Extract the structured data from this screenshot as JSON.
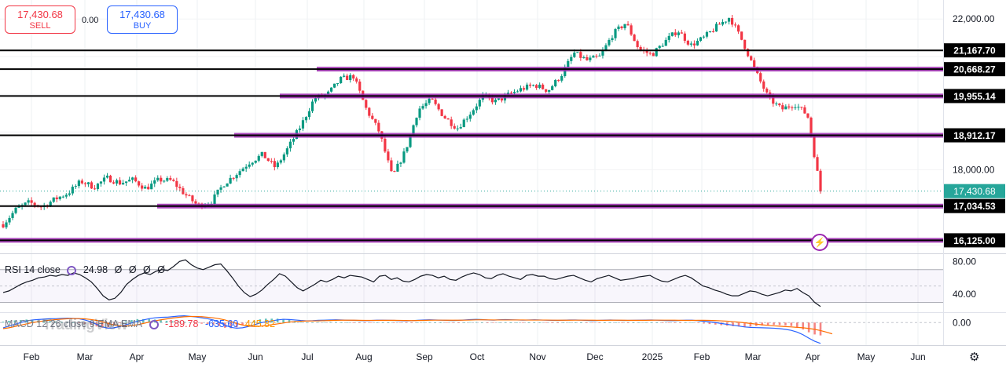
{
  "trade": {
    "sell_price": "17,430.68",
    "sell_label": "SELL",
    "buy_price": "17,430.68",
    "buy_label": "BUY",
    "spread": "0.00"
  },
  "chart_data": [
    {
      "type": "candlestick",
      "title": "",
      "x_ticks": [
        "Feb",
        "Mar",
        "Apr",
        "May",
        "Jun",
        "Jul",
        "Aug",
        "Sep",
        "Oct",
        "Nov",
        "Dec",
        "2025",
        "Feb",
        "Mar",
        "Apr",
        "May",
        "Jun"
      ],
      "y_ticks": [
        "22,000.00",
        "18,000.00"
      ],
      "ylim": [
        15800,
        22400
      ],
      "current_price": 17430.68,
      "current_price_label": "17,430.68",
      "close_series": [
        {
          "date": "2024-01-22",
          "close": 16550
        },
        {
          "date": "2024-01-29",
          "close": 16950
        },
        {
          "date": "2024-02-05",
          "close": 17130
        },
        {
          "date": "2024-02-12",
          "close": 17010
        },
        {
          "date": "2024-02-19",
          "close": 17220
        },
        {
          "date": "2024-02-26",
          "close": 17380
        },
        {
          "date": "2024-03-04",
          "close": 17690
        },
        {
          "date": "2024-03-11",
          "close": 17540
        },
        {
          "date": "2024-03-18",
          "close": 17780
        },
        {
          "date": "2024-03-25",
          "close": 17650
        },
        {
          "date": "2024-04-01",
          "close": 17730
        },
        {
          "date": "2024-04-08",
          "close": 17500
        },
        {
          "date": "2024-04-15",
          "close": 17730
        },
        {
          "date": "2024-04-22",
          "close": 17710
        },
        {
          "date": "2024-04-29",
          "close": 17350
        },
        {
          "date": "2024-05-06",
          "close": 17050
        },
        {
          "date": "2024-05-13",
          "close": 17130
        },
        {
          "date": "2024-05-20",
          "close": 17620
        },
        {
          "date": "2024-05-27",
          "close": 17900
        },
        {
          "date": "2024-06-03",
          "close": 18200
        },
        {
          "date": "2024-06-10",
          "close": 18400
        },
        {
          "date": "2024-06-17",
          "close": 18050
        },
        {
          "date": "2024-06-24",
          "close": 18600
        },
        {
          "date": "2024-07-01",
          "close": 19200
        },
        {
          "date": "2024-07-08",
          "close": 19900
        },
        {
          "date": "2024-07-15",
          "close": 20000
        },
        {
          "date": "2024-07-22",
          "close": 20400
        },
        {
          "date": "2024-07-29",
          "close": 20480
        },
        {
          "date": "2024-08-05",
          "close": 19600
        },
        {
          "date": "2024-08-12",
          "close": 19000
        },
        {
          "date": "2024-08-19",
          "close": 17800
        },
        {
          "date": "2024-08-26",
          "close": 18500
        },
        {
          "date": "2024-09-02",
          "close": 19600
        },
        {
          "date": "2024-09-09",
          "close": 19850
        },
        {
          "date": "2024-09-16",
          "close": 19400
        },
        {
          "date": "2024-09-23",
          "close": 19100
        },
        {
          "date": "2024-09-30",
          "close": 19500
        },
        {
          "date": "2024-10-07",
          "close": 19950
        },
        {
          "date": "2024-10-14",
          "close": 19800
        },
        {
          "date": "2024-10-21",
          "close": 20000
        },
        {
          "date": "2024-10-28",
          "close": 20150
        },
        {
          "date": "2024-11-04",
          "close": 20250
        },
        {
          "date": "2024-11-11",
          "close": 20100
        },
        {
          "date": "2024-11-18",
          "close": 20500
        },
        {
          "date": "2024-11-25",
          "close": 21100
        },
        {
          "date": "2024-12-02",
          "close": 20900
        },
        {
          "date": "2024-12-09",
          "close": 21000
        },
        {
          "date": "2024-12-16",
          "close": 21600
        },
        {
          "date": "2024-12-23",
          "close": 21900
        },
        {
          "date": "2024-12-30",
          "close": 21200
        },
        {
          "date": "2025-01-06",
          "close": 21050
        },
        {
          "date": "2025-01-13",
          "close": 21400
        },
        {
          "date": "2025-01-20",
          "close": 21700
        },
        {
          "date": "2025-01-27",
          "close": 21300
        },
        {
          "date": "2025-02-03",
          "close": 21500
        },
        {
          "date": "2025-02-10",
          "close": 21800
        },
        {
          "date": "2025-02-17",
          "close": 22050
        },
        {
          "date": "2025-02-24",
          "close": 21400
        },
        {
          "date": "2025-03-03",
          "close": 20600
        },
        {
          "date": "2025-03-10",
          "close": 19900
        },
        {
          "date": "2025-03-17",
          "close": 19600
        },
        {
          "date": "2025-03-24",
          "close": 19750
        },
        {
          "date": "2025-03-31",
          "close": 19450
        },
        {
          "date": "2025-04-07",
          "close": 17430.68
        }
      ],
      "levels": [
        {
          "price": 21167.7,
          "label": "21,167.70",
          "style": "black"
        },
        {
          "price": 20668.27,
          "label": "20,668.27",
          "style": "black-purple"
        },
        {
          "price": 19955.14,
          "label": "19,955.14",
          "style": "black-purple"
        },
        {
          "price": 18912.17,
          "label": "18,912.17",
          "style": "black-purple"
        },
        {
          "price": 17034.53,
          "label": "17,034.53",
          "style": "black-purple"
        },
        {
          "price": 16125.0,
          "label": "16,125.00",
          "style": "black-purple"
        }
      ],
      "colors": {
        "up": "#089981",
        "down": "#f23645",
        "level": "#000000",
        "zone": "#9c27b0",
        "price_tag": "#26a69a"
      }
    },
    {
      "type": "line",
      "name": "RSI",
      "ylim": [
        18,
        88
      ],
      "y_ticks": [
        "80.00",
        "40.00"
      ],
      "bands": [
        70,
        30
      ],
      "current": 24.98,
      "values": [
        42,
        44,
        48,
        52,
        55,
        57,
        60,
        61,
        63,
        62,
        64,
        63,
        66,
        64,
        60,
        55,
        47,
        38,
        33,
        35,
        42,
        52,
        58,
        63,
        66,
        64,
        68,
        70,
        69,
        74,
        80,
        82,
        76,
        72,
        70,
        73,
        76,
        77,
        69,
        60,
        50,
        42,
        37,
        40,
        45,
        52,
        58,
        65,
        62,
        55,
        48,
        44,
        48,
        52,
        57,
        55,
        58,
        62,
        60,
        63,
        62,
        61,
        58,
        55,
        62,
        63,
        58,
        60,
        56,
        55,
        58,
        62,
        64,
        63,
        60,
        62,
        58,
        57,
        61,
        64,
        66,
        64,
        60,
        59,
        63,
        65,
        62,
        60,
        58,
        63,
        64,
        62,
        62,
        59,
        58,
        60,
        62,
        63,
        60,
        57,
        55,
        59,
        61,
        63,
        60,
        57,
        58,
        59,
        61,
        62,
        63,
        59,
        56,
        55,
        58,
        61,
        63,
        60,
        55,
        50,
        48,
        45,
        43,
        40,
        38,
        38,
        41,
        44,
        43,
        40,
        38,
        40,
        42,
        45,
        44,
        47,
        42,
        38,
        30,
        25
      ]
    },
    {
      "type": "histogram+lines",
      "name": "MACD",
      "ylim": [
        -260,
        120
      ],
      "y_ticks": [
        "0.00"
      ],
      "macd_current": -189.78,
      "signal_current": -635.6,
      "hist_current": 445.82,
      "macd": [
        -60,
        -40,
        -20,
        0,
        20,
        30,
        35,
        40,
        45,
        45,
        48,
        50,
        48,
        44,
        30,
        10,
        -20,
        -50,
        -65,
        -60,
        -45,
        -25,
        -5,
        15,
        30,
        45,
        55,
        60,
        62,
        68,
        75,
        78,
        72,
        65,
        55,
        45,
        30,
        5,
        -30,
        -55,
        -65,
        -60,
        -45,
        -25,
        -5,
        10,
        20,
        30,
        38,
        35,
        30,
        24,
        20,
        22,
        26,
        28,
        30,
        32,
        30,
        28,
        26,
        24,
        22,
        24,
        27,
        28,
        26,
        25,
        22,
        20,
        22,
        26,
        30,
        32,
        30,
        28,
        26,
        24,
        26,
        30,
        34,
        36,
        34,
        30,
        28,
        32,
        34,
        32,
        30,
        28,
        30,
        32,
        30,
        28,
        26,
        25,
        27,
        30,
        30,
        28,
        25,
        22,
        25,
        28,
        30,
        28,
        25,
        25,
        26,
        28,
        29,
        30,
        28,
        25,
        22,
        22,
        25,
        28,
        27,
        22,
        15,
        8,
        0,
        -10,
        -20,
        -30,
        -40,
        -50,
        -55,
        -58,
        -60,
        -62,
        -65,
        -70,
        -78,
        -90,
        -110,
        -140,
        -180,
        -215,
        -240
      ],
      "signal": [
        -70,
        -60,
        -45,
        -30,
        -15,
        0,
        10,
        20,
        28,
        34,
        40,
        44,
        46,
        46,
        43,
        36,
        25,
        10,
        -10,
        -28,
        -38,
        -40,
        -35,
        -25,
        -10,
        5,
        20,
        32,
        42,
        52,
        60,
        67,
        70,
        70,
        68,
        62,
        55,
        45,
        30,
        10,
        -10,
        -28,
        -40,
        -45,
        -42,
        -35,
        -25,
        -15,
        -5,
        5,
        12,
        16,
        18,
        19,
        20,
        22,
        24,
        26,
        27,
        27,
        27,
        26,
        25,
        25,
        25,
        26,
        26,
        26,
        25,
        24,
        23,
        24,
        25,
        27,
        28,
        28,
        27,
        27,
        27,
        28,
        29,
        31,
        32,
        31,
        30,
        30,
        30,
        30,
        30,
        30,
        29,
        29,
        29,
        29,
        28,
        27,
        27,
        27,
        28,
        28,
        28,
        27,
        26,
        26,
        27,
        27,
        27,
        26,
        26,
        26,
        26,
        27,
        28,
        28,
        28,
        27,
        26,
        25,
        25,
        26,
        26,
        25,
        23,
        20,
        16,
        11,
        5,
        -2,
        -10,
        -18,
        -26,
        -32,
        -38,
        -42,
        -46,
        -50,
        -55,
        -60,
        -68,
        -78,
        -92,
        -110,
        -130
      ]
    }
  ],
  "indicators": {
    "rsi": {
      "label": "RSI 14 close",
      "value": "24.98",
      "extras": [
        "Ø",
        "Ø",
        "Ø",
        "Ø"
      ]
    },
    "macd": {
      "label": "MACD 12 26 close 9 EMA EMA",
      "macd": "-189.78",
      "signal": "-635.60",
      "hist": "445.82"
    }
  },
  "watermark": "TradingView",
  "bolt_icon": "lightning-icon",
  "settings_icon": "gear-icon"
}
